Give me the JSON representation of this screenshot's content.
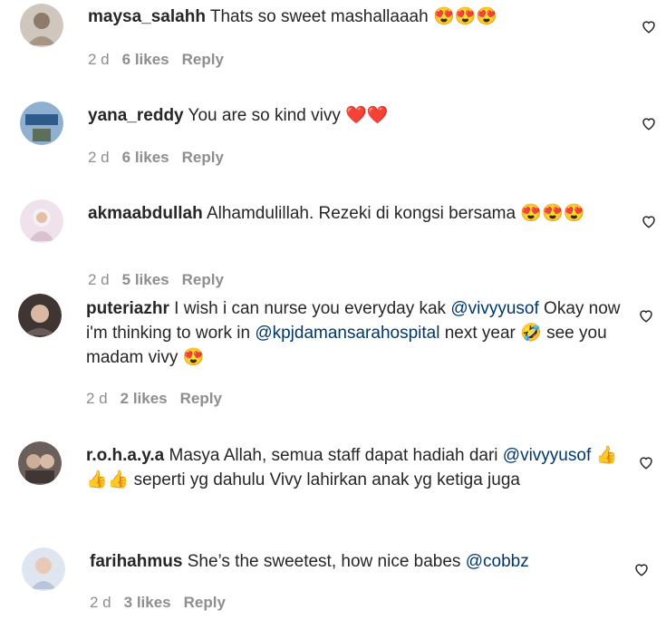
{
  "comments": [
    {
      "username": "maysa_salahh",
      "segments": [
        {
          "t": "text",
          "v": " Thats so sweet mashallaaah "
        },
        {
          "t": "emoji",
          "v": "😍😍😍"
        }
      ],
      "time": "2 d",
      "likes": "6 likes",
      "reply": "Reply",
      "avatar_color": "#b9a89a"
    },
    {
      "username": "yana_reddy",
      "segments": [
        {
          "t": "text",
          "v": " You are so kind vivy "
        },
        {
          "t": "emoji",
          "v": "❤️❤️"
        }
      ],
      "time": "2 d",
      "likes": "6 likes",
      "reply": "Reply",
      "avatar_color": "#6f8fb3"
    },
    {
      "username": "akmaabdullah",
      "segments": [
        {
          "t": "text",
          "v": " Alhamdulillah. Rezeki di kongsi bersama "
        },
        {
          "t": "emoji",
          "v": "😍😍😍"
        }
      ],
      "time": "2 d",
      "likes": "5 likes",
      "reply": "Reply",
      "avatar_color": "#e8d7e4"
    },
    {
      "username": "puteriazhr",
      "segments": [
        {
          "t": "text",
          "v": " I wish i can nurse you everyday kak "
        },
        {
          "t": "mention",
          "v": "@vivyyusof"
        },
        {
          "t": "text",
          "v": " Okay now i'm thinking to work in "
        },
        {
          "t": "mention",
          "v": "@kpjdamansarahospital"
        },
        {
          "t": "text",
          "v": " next year "
        },
        {
          "t": "emoji",
          "v": "🤣"
        },
        {
          "t": "text",
          "v": " see you madam vivy "
        },
        {
          "t": "emoji",
          "v": "😍"
        }
      ],
      "time": "2 d",
      "likes": "2 likes",
      "reply": "Reply",
      "avatar_color": "#3b3230"
    },
    {
      "username": "r.o.h.a.y.a",
      "segments": [
        {
          "t": "text",
          "v": " Masya Allah, semua staff dapat hadiah dari "
        },
        {
          "t": "mention",
          "v": "@vivyyusof"
        },
        {
          "t": "text",
          "v": " "
        },
        {
          "t": "emoji",
          "v": "👍👍👍"
        },
        {
          "t": "text",
          "v": " seperti yg dahulu Vivy lahirkan anak yg ketiga juga"
        }
      ],
      "time": "",
      "likes": "",
      "reply": "",
      "avatar_color": "#5a4a48"
    },
    {
      "username": "farihahmus",
      "segments": [
        {
          "t": "text",
          "v": " She’s the sweetest, how nice babes "
        },
        {
          "t": "mention",
          "v": "@cobbz"
        }
      ],
      "time": "2 d",
      "likes": "3 likes",
      "reply": "Reply",
      "avatar_color": "#cfd8e6"
    }
  ]
}
